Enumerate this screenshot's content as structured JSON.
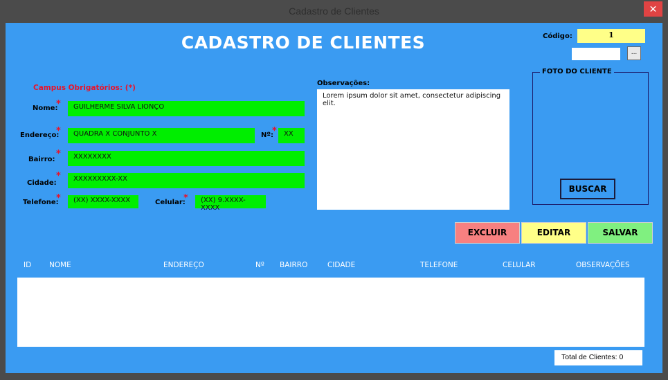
{
  "window": {
    "title": "Cadastro de Clientes",
    "close_label": "✕"
  },
  "form": {
    "heading": "CADASTRO DE CLIENTES",
    "required_note": "Campus Obrigatórios: (*)",
    "required_mark": "*",
    "code_label": "Código:",
    "code_value": "1",
    "code_extra_value": "",
    "browse_label": "...",
    "photo_label": "FOTO DO CLIENTE",
    "search_label": "BUSCAR",
    "fields": {
      "nome": {
        "label": "Nome:",
        "value": "GUILHERME SILVA LIONÇO"
      },
      "endereco": {
        "label": "Endereço:",
        "value": "QUADRA X CONJUNTO X"
      },
      "numero": {
        "label": "Nº:",
        "value": "XX"
      },
      "bairro": {
        "label": "Bairro:",
        "value": "XXXXXXXX"
      },
      "cidade": {
        "label": "Cidade:",
        "value": "XXXXXXXXX-XX"
      },
      "telefone": {
        "label": "Telefone:",
        "value": "(XX) XXXX-XXXX"
      },
      "celular": {
        "label": "Celular:",
        "value": "(XX) 9.XXXX-XXXX"
      }
    },
    "observacoes": {
      "label": "Observações:",
      "value": "Lorem ipsum dolor sit amet, consectetur adipiscing elit."
    },
    "buttons": {
      "excluir": "EXCLUIR",
      "editar": "EDITAR",
      "salvar": "SALVAR"
    },
    "table": {
      "columns": [
        "ID",
        "NOME",
        "ENDEREÇO",
        "Nº",
        "BAIRRO",
        "CIDADE",
        "TELEFONE",
        "CELULAR",
        "OBSERVAÇÕES"
      ],
      "rows": []
    },
    "total_label": "Total de Clientes: 0"
  },
  "colors": {
    "form_background": "#3a9bf2",
    "field_green": "#00ee00",
    "required_red": "#e8132b",
    "code_yellow": "#ffff88",
    "excluir": "#f78080",
    "editar": "#ffff88",
    "salvar": "#80f080"
  }
}
